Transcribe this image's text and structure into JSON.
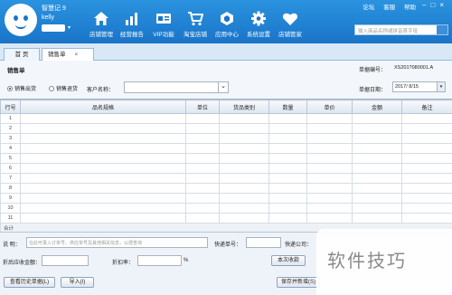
{
  "app": {
    "name": "智慧记 9",
    "user": "kelly"
  },
  "nav": [
    {
      "label": "店铺管理",
      "icon": "home-icon"
    },
    {
      "label": "经营报告",
      "icon": "bar-chart-icon"
    },
    {
      "label": "VIP功能",
      "icon": "vip-icon"
    },
    {
      "label": "淘宝店铺",
      "icon": "cart-icon"
    },
    {
      "label": "应用中心",
      "icon": "app-hexagon-icon"
    },
    {
      "label": "系统设置",
      "icon": "gear-icon"
    },
    {
      "label": "店铺管家",
      "icon": "heart-icon"
    }
  ],
  "top_links": {
    "forum": "论坛",
    "service": "客服",
    "help": "帮助"
  },
  "search": {
    "placeholder": "输入商品名称或拼音首字母"
  },
  "tabs": [
    {
      "label": "首 页"
    },
    {
      "label": "销售单",
      "close": "×"
    }
  ],
  "form": {
    "title": "销售单",
    "doc_no_label": "单据编号：",
    "doc_no": "XS201?080001.A",
    "radio_sale": "销售出货",
    "radio_return": "销售退货",
    "customer_label": "客户名称：",
    "date_label": "单据日期：",
    "date": "2017/ 8/15"
  },
  "table": {
    "headers": [
      "行号",
      "品名规格",
      "单位",
      "货品类别",
      "数量",
      "单价",
      "金额",
      "备注"
    ],
    "rows": [
      "1",
      "2",
      "3",
      "4",
      "5",
      "6",
      "7",
      "8",
      "9",
      "10",
      "11"
    ],
    "total": "合计"
  },
  "footer": {
    "note_label": "说  明：",
    "note_placeholder": "在此可录入订单号、供应单号及其他相关信息，以便查询",
    "express_no_label": "快递单号：",
    "express_co_label": "快递公司：",
    "receivable_label": "折后应收金额：",
    "discount_label": "折扣率：",
    "percent": "%",
    "this_receipt": "本次收款",
    "history_btn": "查看历史单据(L)",
    "import_btn": "导入(I)",
    "save_new_btn": "保存并新增(S)"
  },
  "watermark": "软件技巧",
  "colors": {
    "topbar": "#1a74c8",
    "accent": "#2a80c8"
  }
}
